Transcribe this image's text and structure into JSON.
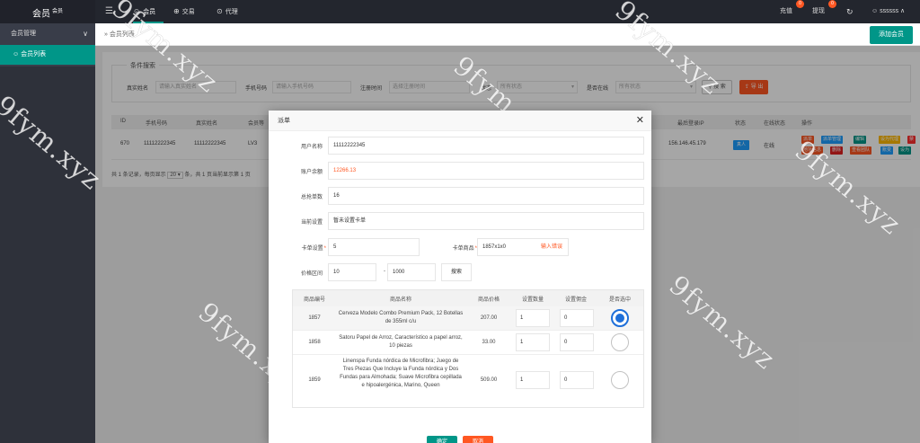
{
  "app": {
    "logo": "会员",
    "logo_sup": "会员",
    "menu_icon": "hamburger-icon"
  },
  "topnav": {
    "items": [
      {
        "label": "会员",
        "icon": "user-icon"
      },
      {
        "label": "交易",
        "icon": "exchange-icon"
      },
      {
        "label": "代理",
        "icon": "agent-icon"
      }
    ],
    "recharge": "充值",
    "recharge_badge": "0",
    "withdraw": "提现",
    "withdraw_badge": "0",
    "refresh_icon": "refresh-icon",
    "username": "ssssss"
  },
  "sidebar": {
    "group": "会员管理",
    "item": "会员列表"
  },
  "breadcrumb": {
    "text": "会员列表",
    "add_button": "添加会员"
  },
  "filters": {
    "legend": "条件搜索",
    "realname_label": "真实姓名",
    "realname_placeholder": "请输入真实姓名",
    "phone_label": "手机号码",
    "phone_placeholder": "请输入手机号码",
    "regtime_label": "注册时间",
    "regtime_placeholder": "选择注册时间",
    "status_label": "状态",
    "status_value": "所有状态",
    "online_label": "是否在线",
    "online_value": "所有状态",
    "search_button": "搜 索",
    "export_button": "导 出"
  },
  "table": {
    "headers": [
      "ID",
      "手机号码",
      "真实姓名",
      "会员等",
      "最后登录IP",
      "状态",
      "在线状态",
      "操作"
    ],
    "row": {
      "id": "670",
      "phone": "11112222345",
      "name": "11112222345",
      "level": "LV3",
      "ip": "156.146.45.179",
      "status": "真人",
      "online": "在线",
      "actions": [
        {
          "label": "派单",
          "color": "#ff5722"
        },
        {
          "label": "派单管理",
          "color": "#1e9fff"
        },
        {
          "label": "编辑",
          "color": "#009688"
        },
        {
          "label": "设为代理",
          "color": "#ffb800"
        },
        {
          "label": "禁用",
          "color": "#ff2d2d"
        },
        {
          "label": "地址信息",
          "color": "#ff5722"
        },
        {
          "label": "删除",
          "color": "#e02020"
        },
        {
          "label": "查看团队",
          "color": "#ff5722"
        },
        {
          "label": "账变",
          "color": "#1e9fff"
        },
        {
          "label": "设为假",
          "color": "#009688"
        }
      ]
    },
    "pager": {
      "prefix": "共 1 条记录，每页显示",
      "size": "20",
      "suffix": "条，共 1 页当前显示第 1 页"
    }
  },
  "modal": {
    "title": "派单",
    "username_label": "用户名称",
    "username_value": "11112222345",
    "balance_label": "账户余额",
    "balance_value": "12266.13",
    "total_label": "总抢单数",
    "total_value": "16",
    "current_label": "当前设置",
    "current_value": "暂未设置卡单",
    "card_label": "卡单设置",
    "card_value": "5",
    "goods_label": "卡单商品",
    "goods_value": "1857x1x0",
    "goods_error": "输入错误",
    "price_label": "价格区间",
    "price_min": "10",
    "price_sep": "-",
    "price_max": "1000",
    "search_button": "搜索",
    "goods_headers": [
      "商品编号",
      "商品名称",
      "商品价格",
      "设置数量",
      "设置佣金",
      "是否选中"
    ],
    "goods": [
      {
        "id": "1857",
        "name": "Cerveza Modelo Combo Premium Pack, 12 Botellas de 355ml c/u",
        "price": "207.00",
        "qty": "1",
        "commission": "0",
        "selected": true
      },
      {
        "id": "1858",
        "name": "Satoru Papel de Arroz, Característico a papel arroz, 10 piezas",
        "price": "33.00",
        "qty": "1",
        "commission": "0",
        "selected": false
      },
      {
        "id": "1859",
        "name": "Linenspa Funda nórdica de Microfibra; Juego de Tres Piezas Que Incluye la Funda nórdica y Dos Fundas para Almohada; Suave Microfibra cepillada e hipoalergénica, Marino, Queen",
        "price": "509.00",
        "qty": "1",
        "commission": "0",
        "selected": false
      }
    ],
    "confirm_button": "确定",
    "cancel_button": "取消"
  },
  "watermark": "9fym.xyz",
  "colors": {
    "accent": "#009688",
    "danger": "#ff5722",
    "primary": "#1e9fff"
  }
}
